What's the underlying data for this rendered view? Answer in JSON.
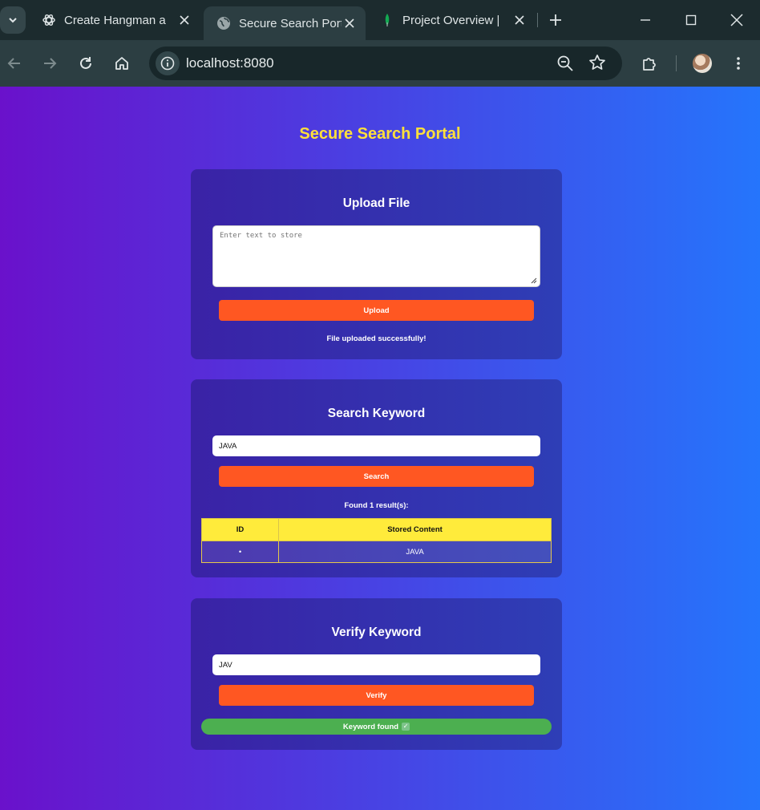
{
  "browser": {
    "tabs": [
      {
        "title": "Create Hangman a",
        "icon": "openai-icon",
        "active": false
      },
      {
        "title": "Secure Search Port",
        "icon": "globe-icon",
        "active": true
      },
      {
        "title": "Project Overview |",
        "icon": "leaf-icon",
        "active": false
      }
    ],
    "url": "localhost:8080"
  },
  "page": {
    "title": "Secure Search Portal",
    "upload": {
      "heading": "Upload File",
      "placeholder": "Enter text to store",
      "button_label": "Upload",
      "status": "File uploaded successfully!"
    },
    "search": {
      "heading": "Search Keyword",
      "value": "JAVA",
      "button_label": "Search",
      "result_summary": "Found 1 result(s):",
      "columns": [
        "ID",
        "Stored Content"
      ],
      "rows": [
        {
          "id": "•",
          "content": "JAVA"
        }
      ]
    },
    "verify": {
      "heading": "Verify Keyword",
      "value": "JAV",
      "button_label": "Verify",
      "result": "Keyword found",
      "result_icon": "check-icon"
    }
  },
  "colors": {
    "accent_button": "#ff5722",
    "title": "#ffe03a",
    "table_header": "#ffeb3b",
    "success": "#4caf50",
    "gradient_start": "#6a11cb",
    "gradient_end": "#2575fc"
  }
}
